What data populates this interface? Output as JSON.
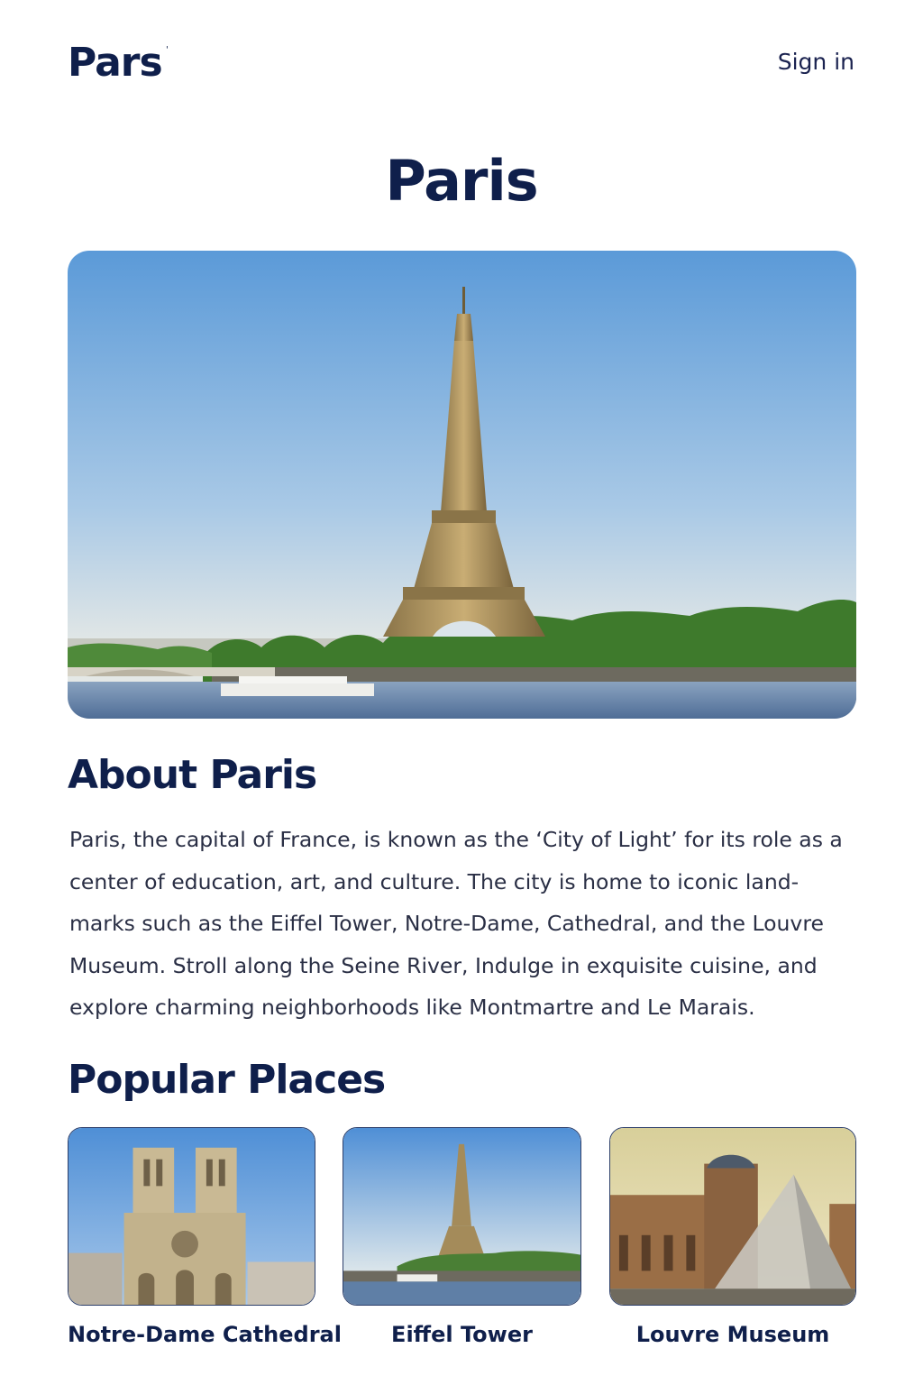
{
  "header": {
    "logo": "Pars",
    "logo_mark": "'",
    "signin": "Sign in"
  },
  "page_title": "Paris",
  "about": {
    "heading": "About Paris",
    "text": "Paris, the capital of France, is known as the ‘City of Light’ for its role as a center of education, art, and culture. The city is home to iconic land-marks such as the Eiffel Tower, Notre-Dame, Cathedral, and the Louvre Museum. Stroll along the Seine River, Indulge in exquisite cuisine, and explore charming neighborhoods like Montmartre and Le Marais."
  },
  "places": {
    "heading": "Popular Places",
    "items": [
      {
        "label": "Notre-Dame Cathedral"
      },
      {
        "label": "Eiffel Tower"
      },
      {
        "label": "Louvre Museum"
      }
    ]
  },
  "colors": {
    "text": "#0f1f4b",
    "sky_top": "#5b9ad8",
    "sky_bottom": "#e4e8e6",
    "foliage": "#3e7a2c",
    "river": "#5f7fa6"
  }
}
